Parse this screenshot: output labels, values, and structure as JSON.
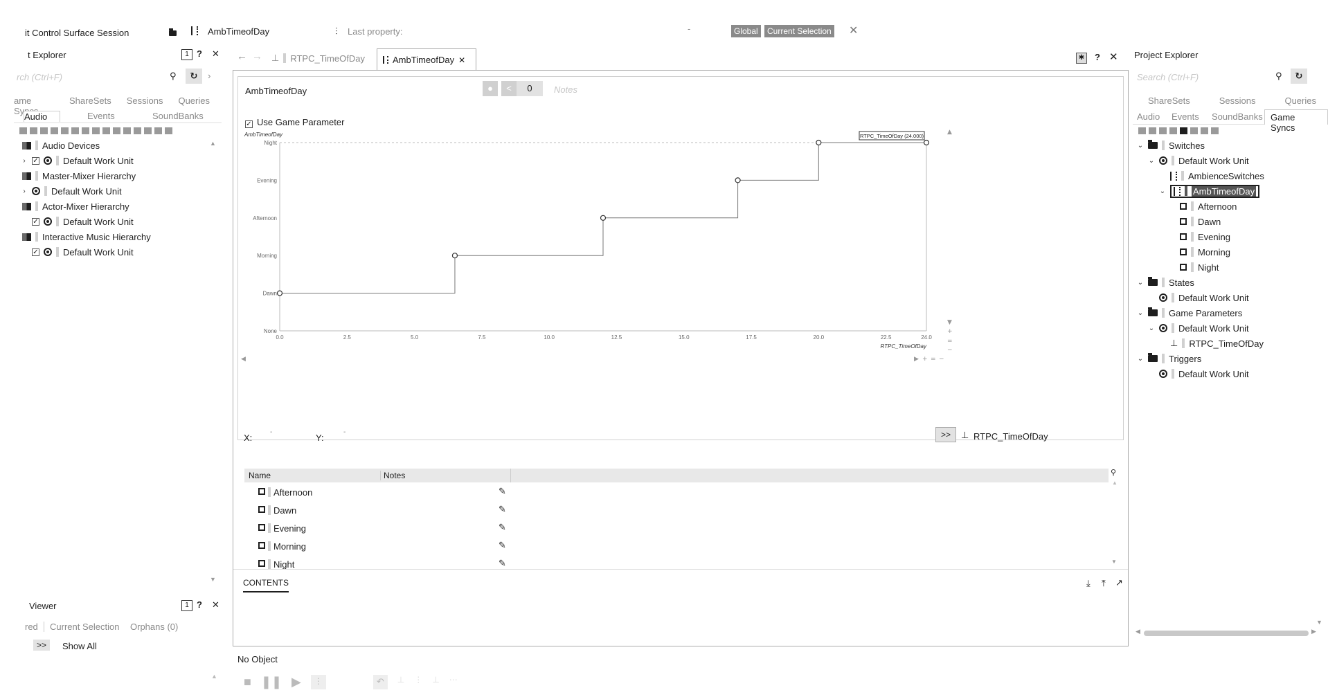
{
  "topbar": {
    "session_label": "it Control Surface Session",
    "object_name": "AmbTimeofDay",
    "last_property_label": "Last property:",
    "last_property_value": "-",
    "global_label": "Global",
    "current_selection_label": "Current Selection"
  },
  "left_explorer": {
    "title": "t Explorer",
    "badge": "1",
    "search_placeholder": "rch (Ctrl+F)",
    "tabs_row1": [
      "ame Syncs",
      "ShareSets",
      "Sessions",
      "Queries"
    ],
    "tabs_row2": [
      "Audio",
      "Events",
      "SoundBanks"
    ],
    "tree": [
      {
        "label": "Audio Devices"
      },
      {
        "label": "Default Work Unit"
      },
      {
        "label": "Master-Mixer Hierarchy"
      },
      {
        "label": "Default Work Unit"
      },
      {
        "label": "Actor-Mixer Hierarchy"
      },
      {
        "label": "Default Work Unit"
      },
      {
        "label": "Interactive Music Hierarchy"
      },
      {
        "label": "Default Work Unit"
      }
    ]
  },
  "viewer": {
    "title": "Viewer",
    "badge": "1",
    "tabs": [
      "red",
      "Current Selection",
      "Orphans (0)"
    ],
    "show_all_button": ">>",
    "show_all_label": "Show All"
  },
  "editor": {
    "tabs": [
      {
        "label": "RTPC_TimeOfDay"
      },
      {
        "label": "AmbTimeofDay"
      }
    ],
    "object_name": "AmbTimeofDay",
    "share_count": "0",
    "notes_placeholder": "Notes",
    "use_game_parameter_label": "Use Game Parameter",
    "x_label": "X:",
    "y_label": "Y:",
    "x_value": "-",
    "y_value": "-",
    "rtpc_button": ">>",
    "rtpc_name": "RTPC_TimeOfDay",
    "table": {
      "headers": [
        "Name",
        "Notes"
      ],
      "rows": [
        "Afternoon",
        "Dawn",
        "Evening",
        "Morning",
        "Night"
      ]
    },
    "contents_tab": "CONTENTS",
    "no_object": "No Object"
  },
  "chart_data": {
    "type": "line",
    "title": "",
    "ylabel": "AmbTimeofDay",
    "xlabel": "RTPC_TimeOfDay",
    "x_ticks": [
      "0.0",
      "2.5",
      "5.0",
      "7.5",
      "10.0",
      "12.5",
      "15.0",
      "17.5",
      "20.0",
      "22.5",
      "24.0"
    ],
    "y_categories": [
      "None",
      "Dawn",
      "Morning",
      "Afternoon",
      "Evening",
      "Night"
    ],
    "xlim": [
      0,
      24
    ],
    "series": [
      {
        "points": [
          {
            "x": 0.0,
            "y": "Dawn"
          },
          {
            "x": 6.5,
            "y": "Morning"
          },
          {
            "x": 12.0,
            "y": "Afternoon"
          },
          {
            "x": 17.0,
            "y": "Evening"
          },
          {
            "x": 20.0,
            "y": "Night"
          },
          {
            "x": 24.0,
            "y": "Night"
          }
        ]
      }
    ],
    "tooltip": "RTPC_TimeOfDay (24.000)",
    "step_interpolation": true
  },
  "right_explorer": {
    "title": "Project Explorer",
    "search_placeholder": "Search (Ctrl+F)",
    "tabs_row1": [
      "ShareSets",
      "Sessions",
      "Queries"
    ],
    "tabs_row2": [
      "Audio",
      "Events",
      "SoundBanks",
      "Game Syncs"
    ],
    "tree": [
      {
        "label": "Switches"
      },
      {
        "label": "Default Work Unit"
      },
      {
        "label": "AmbienceSwitches"
      },
      {
        "label": "AmbTimeofDay"
      },
      {
        "label": "Afternoon"
      },
      {
        "label": "Dawn"
      },
      {
        "label": "Evening"
      },
      {
        "label": "Morning"
      },
      {
        "label": "Night"
      },
      {
        "label": "States"
      },
      {
        "label": "Default Work Unit"
      },
      {
        "label": "Game Parameters"
      },
      {
        "label": "Default Work Unit"
      },
      {
        "label": "RTPC_TimeOfDay"
      },
      {
        "label": "Triggers"
      },
      {
        "label": "Default Work Unit"
      }
    ]
  }
}
